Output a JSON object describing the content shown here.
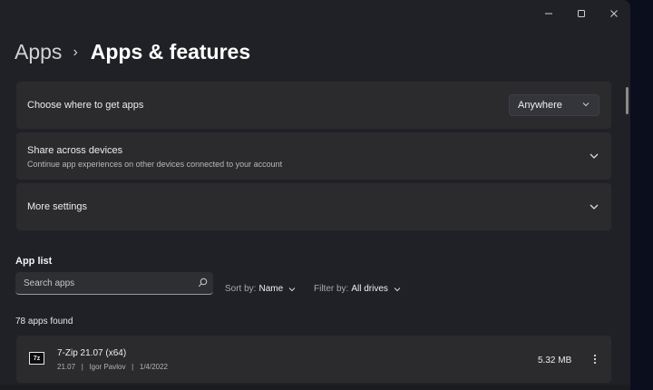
{
  "window": {
    "controls": {
      "minimize": "—",
      "maximize": "▢",
      "close": "✕"
    }
  },
  "breadcrumb": {
    "parent": "Apps",
    "separator": "›",
    "current": "Apps & features"
  },
  "settings": {
    "get_apps": {
      "title": "Choose where to get apps",
      "dropdown_value": "Anywhere"
    },
    "share": {
      "title": "Share across devices",
      "subtitle": "Continue app experiences on other devices connected to your account"
    },
    "more": {
      "title": "More settings"
    }
  },
  "app_list": {
    "label": "App list",
    "search_placeholder": "Search apps",
    "sort_label": "Sort by:",
    "sort_value": "Name",
    "filter_label": "Filter by:",
    "filter_value": "All drives",
    "count_text": "78 apps found",
    "apps": [
      {
        "icon_text": "7z",
        "name": "7-Zip 21.07 (x64)",
        "meta": "21.07   |   Igor Pavlov   |   1/4/2022",
        "size": "5.32 MB"
      }
    ]
  },
  "colors": {
    "window_bg": "#202126",
    "card_bg": "#2b2b2e",
    "text": "#f0f0f0",
    "desktop_accent": "#1f3a8a"
  },
  "icons": [
    "search-icon",
    "chevron-down-icon",
    "chevron-right-icon",
    "more-options-icon",
    "app-icon-7zip"
  ]
}
